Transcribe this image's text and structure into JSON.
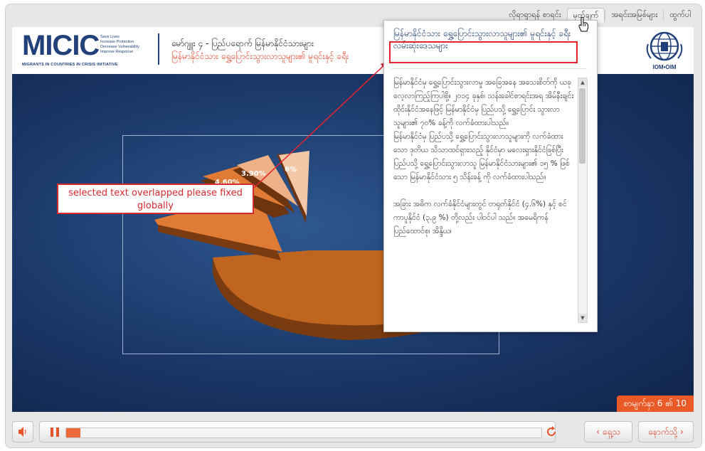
{
  "topnav": {
    "items": [
      "လိုရာရှာရန် စာရင်း",
      "မှတ်ချက်",
      "အရင်းအမြစ်များ",
      "ထွက်ပါ"
    ],
    "active_index": 1
  },
  "header": {
    "logo_text": "MICIC",
    "logo_taglines": [
      "Save Lives",
      "Increase Protection",
      "Decrease Vulnerability",
      "Improve Response"
    ],
    "logo_subtitle": "MIGRANTS IN COUNTRIES IN CRISIS INITIATIVE",
    "module_title": "မော်ဂျူး ၄ - ပြည်ပရောက် မြန်မာနိုင်ငံသားများ",
    "module_subtitle": "မြန်မာနိုင်ငံသား ရွှေ့ပြောင်းသွားလာသူများ၏ မူရင်းနှင့် ခရီး",
    "partner_logo_text": "IOM•OIM"
  },
  "chart_data": {
    "type": "pie",
    "style": "3d-exploded",
    "data_labels": [
      "4.60%",
      "3.90%",
      "6%"
    ],
    "colors": {
      "main": "#c0651f",
      "slice1": "#e07b35",
      "slice2": "#eeb086",
      "slice3": "#f3c8a8"
    }
  },
  "popup": {
    "title": "မြန်မာနိုင်ငံသား ရွှေ့ပြောင်းသွားလာသူများ၏ မူရင်းနှင့် ခရီးလမ်းဆုံးဒေသများ",
    "paragraphs": [
      "မြန်မာနိုင်ငံမှ ရွှေ့ပြောင်းသွားလာမှု အခြေအနေ အသေးစိတ်ကို ယခု လေ့လာကြည့်ကြပါစို့။ ၂၀၁၄ ခုနှစ်၊ သန်းခေါင်စာရင်းအရ အိမ်နီးချင်း ထိုင်းနိုင်ငံအနေဖြင့် မြန်မာနိုင်ငံမှ ပြည်ပသို့ ရွှေ့ပြောင်း သွားလာသူများ၏ ၇၀% ခန့်ကို လက်ခံထားပါသည်။",
      "မြန်မာနိုင်ငံမှ ပြည်ပသို့ ရွှေ့ပြောင်းသွားလာသူများကို လက်ခံထားသော ဒုတိယ သိသာထင်ရှားသည့် နိုင်ငံမှာ မလေးရှားနိုင်ငံဖြစ်ပြီး ပြည်ပသို့ ရွှေ့ပြောင်းသွားလာသူ မြန်မာနိုင်ငံသားများ၏ ၁၅ % ဖြစ်သော မြန်မာနိုင်ငံသား ၅ သိန်းခန့် ကို လက်ခံထားပါသည်။",
      "အခြား အဓိက လက်ခံနိုင်ငံများတွင် တရုတ်နိုင်ငံ (၄.၆%) နှင့် စင်ကာပူနိုင်ငံ (၃.၉ %) တို့လည်း ပါဝင်ပါ သည်။ အမေရိကန်ပြည်ထောင်စု၊ အိန္ဒိယ၊"
    ]
  },
  "annotation": {
    "note": "selected text overlapped please fixed globally",
    "color": "#d62a2f"
  },
  "stage": {
    "page_indicator": "စာမျက်နှာ 6 ၏ 10"
  },
  "player": {
    "progress_fraction": 0.03,
    "prev_label": "ရှေ့သ",
    "next_label": "နောက်သို့"
  }
}
